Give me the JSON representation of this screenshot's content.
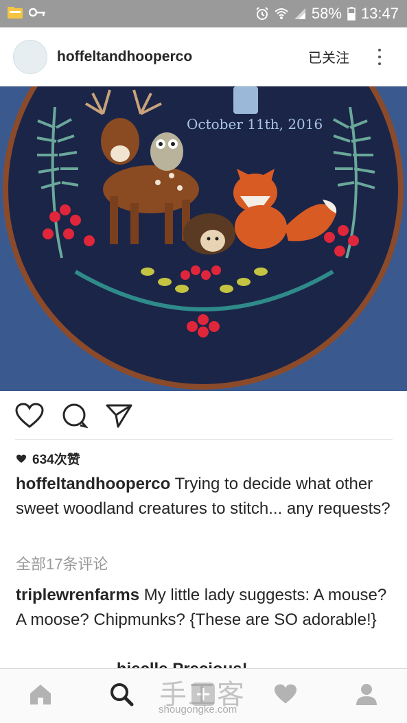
{
  "status_bar": {
    "battery": "58%",
    "time": "13:47",
    "icons": [
      "notification-folder-icon",
      "key-icon",
      "alarm-icon",
      "wifi-icon",
      "signal-icon",
      "battery-icon"
    ]
  },
  "header": {
    "username": "hoffeltandhooperco",
    "follow_label": "已关注"
  },
  "photo": {
    "embroidery_text": "October 11th, 2016"
  },
  "post": {
    "likes": "634次赞",
    "caption_user": "hoffeltandhooperco",
    "caption_text": " Trying to decide what other sweet woodland creatures to stitch... any requests?",
    "view_all_comments": "全部17条评论",
    "comment_user": "triplewrenfarms",
    "comment_text": " My little lady suggests: A mouse? A moose? Chipmunks? {These are SO adorable!}",
    "next_comment_peek": "___________hieclle  Precious!"
  },
  "watermark": {
    "cn": "手工客",
    "en": "shougongke.com"
  },
  "colors": {
    "status_bar": "#9a9a9a",
    "background": "#ffffff",
    "photo_fabric": "#1b2548",
    "hoop": "#8b4a2a"
  }
}
